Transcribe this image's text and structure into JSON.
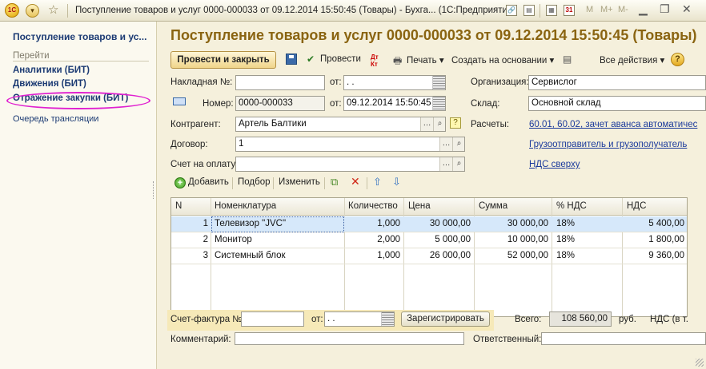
{
  "window": {
    "title": "Поступление товаров и услуг 0000-000033 от 09.12.2014 15:50:45 (Товары) - Бухга... (1С:Предприятие)",
    "logo_text": "1С",
    "mem_buttons": [
      "M",
      "M+",
      "M-"
    ],
    "calendar_day": "31"
  },
  "nav": {
    "title": "Поступление товаров и ус...",
    "section": "Перейти",
    "items": [
      "Аналитики (БИТ)",
      "Движения (БИТ)",
      "Отражение закупки (БИТ)"
    ],
    "extra": "Очередь трансляции"
  },
  "doc": {
    "title": "Поступление товаров и услуг 0000-000033 от 09.12.2014 15:50:45 (Товары)"
  },
  "toolbar": {
    "post_close": "Провести и закрыть",
    "post": "Провести",
    "print": "Печать",
    "create_based": "Создать на основании",
    "all_actions": "Все действия",
    "help": "?"
  },
  "fields": {
    "invoice_label": "Накладная №:",
    "invoice_value": "",
    "from_label": "от:",
    "invoice_date": " .  .",
    "number_label": "Номер:",
    "number_value": "0000-000033",
    "date_value": "09.12.2014 15:50:45",
    "counterparty_label": "Контрагент:",
    "counterparty_value": "Артель Балтики",
    "contract_label": "Договор:",
    "contract_value": "1",
    "payment_label": "Счет на оплату:",
    "payment_value": "",
    "org_label": "Организация:",
    "org_value": "Сервислог",
    "warehouse_label": "Склад:",
    "warehouse_value": "Основной склад",
    "settlements_label": "Расчеты:",
    "settlements_link": "60.01, 60.02, зачет аванса автоматичес",
    "shipper_link": "Грузоотправитель и грузополучатель",
    "vat_link": "НДС сверху"
  },
  "table_toolbar": {
    "add": "Добавить",
    "select": "Подбор",
    "edit": "Изменить"
  },
  "table": {
    "headers": [
      "N",
      "Номенклатура",
      "Количество",
      "Цена",
      "Сумма",
      "% НДС",
      "НДС"
    ],
    "rows": [
      {
        "n": "1",
        "name": "Телевизор \"JVC\"",
        "qty": "1,000",
        "price": "30 000,00",
        "sum": "30 000,00",
        "vat_rate": "18%",
        "vat": "5 400,00"
      },
      {
        "n": "2",
        "name": "Монитор",
        "qty": "2,000",
        "price": "5 000,00",
        "sum": "10 000,00",
        "vat_rate": "18%",
        "vat": "1 800,00"
      },
      {
        "n": "3",
        "name": "Системный блок",
        "qty": "1,000",
        "price": "26 000,00",
        "sum": "52 000,00",
        "vat_rate": "18%",
        "vat": "9 360,00"
      }
    ]
  },
  "footer": {
    "invoice_label": "Счет-фактура №:",
    "from_label": "от:",
    "date_value": " .  .",
    "register_btn": "Зарегистрировать",
    "total_label": "Всего:",
    "total_value": "108 560,00",
    "currency": "руб.",
    "vat_label": "НДС (в т.",
    "comment_label": "Комментарий:",
    "responsible_label": "Ответственный:"
  },
  "colors": {
    "title_accent": "#8a6411",
    "nav_link": "#1b3a73",
    "highlight_oval": "#e020d0",
    "selected_row": "#d6e8fa"
  }
}
